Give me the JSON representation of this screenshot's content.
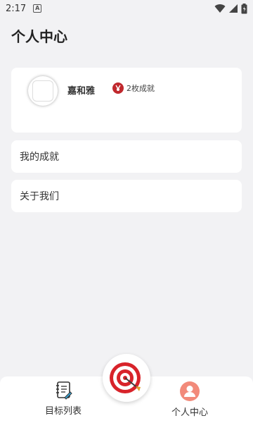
{
  "status_bar": {
    "time": "2:17",
    "notification_icon_label": "A",
    "icons": [
      "wifi-icon",
      "signal-icon",
      "battery-icon"
    ]
  },
  "header": {
    "title": "个人中心"
  },
  "profile": {
    "username": "嘉和雅",
    "badge_text": "2枚成就",
    "badge_color": "#c0282d"
  },
  "menu": {
    "achievements_label": "我的成就",
    "about_label": "关于我们"
  },
  "bottom_nav": {
    "goals_label": "目标列表",
    "profile_label": "个人中心",
    "center_icon": "target-icon",
    "profile_accent": "#f28a7a"
  }
}
